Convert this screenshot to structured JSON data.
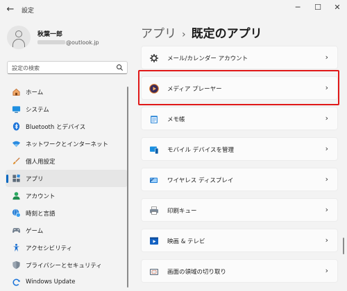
{
  "window": {
    "title": "設定",
    "back": "←",
    "minimize": "─",
    "maximize": "☐",
    "close": "✕"
  },
  "user": {
    "name": "秋葉一郎",
    "email_suffix": "@outlook.jp"
  },
  "search": {
    "placeholder": "設定の検索"
  },
  "sidebar": {
    "items": [
      {
        "label": "ホーム",
        "icon": "home-icon"
      },
      {
        "label": "システム",
        "icon": "system-icon"
      },
      {
        "label": "Bluetooth とデバイス",
        "icon": "bluetooth-icon"
      },
      {
        "label": "ネットワークとインターネット",
        "icon": "wifi-icon"
      },
      {
        "label": "個人用設定",
        "icon": "brush-icon"
      },
      {
        "label": "アプリ",
        "icon": "apps-icon",
        "selected": true
      },
      {
        "label": "アカウント",
        "icon": "account-icon"
      },
      {
        "label": "時刻と言語",
        "icon": "globe-clock-icon"
      },
      {
        "label": "ゲーム",
        "icon": "gamepad-icon"
      },
      {
        "label": "アクセシビリティ",
        "icon": "accessibility-icon"
      },
      {
        "label": "プライバシーとセキュリティ",
        "icon": "shield-icon"
      },
      {
        "label": "Windows Update",
        "icon": "update-icon"
      }
    ]
  },
  "breadcrumb": {
    "parent": "アプリ",
    "separator": "›",
    "current": "既定のアプリ"
  },
  "apps": [
    {
      "label": "メール/カレンダー アカウント",
      "icon": "gear-icon"
    },
    {
      "label": "メディア プレーヤー",
      "icon": "media-player-icon",
      "highlighted": true
    },
    {
      "label": "メモ帳",
      "icon": "notepad-icon"
    },
    {
      "label": "モバイル デバイスを管理",
      "icon": "mobile-devices-icon"
    },
    {
      "label": "ワイヤレス ディスプレイ",
      "icon": "wireless-display-icon"
    },
    {
      "label": "印刷キュー",
      "icon": "printer-icon"
    },
    {
      "label": "映画 & テレビ",
      "icon": "movies-tv-icon"
    },
    {
      "label": "画面の領域の切り取り",
      "icon": "snipping-icon"
    }
  ],
  "chevron": "›",
  "colors": {
    "accent": "#0067c0",
    "highlight_border": "#e01818"
  }
}
